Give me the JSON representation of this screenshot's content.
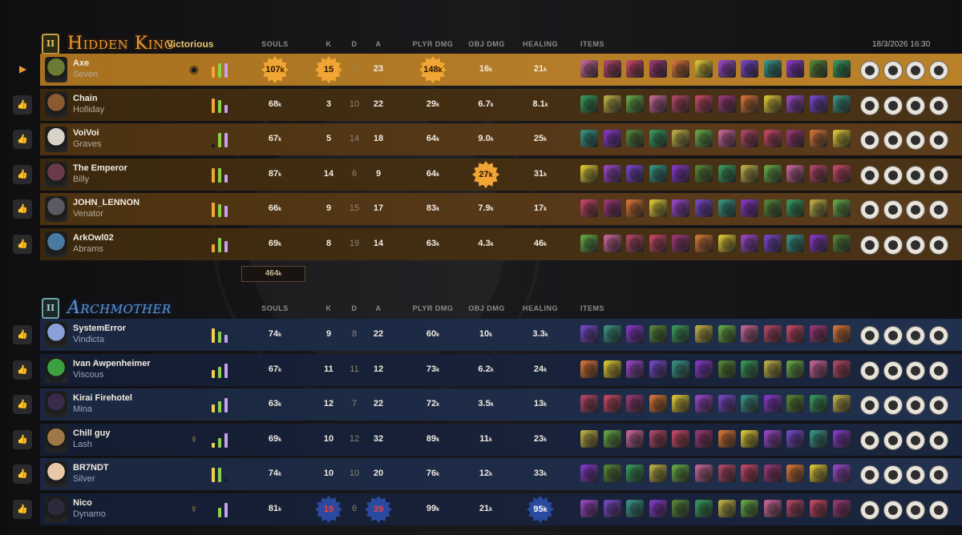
{
  "teams": [
    {
      "id": "amber",
      "badge": "II",
      "name": "Hidden King",
      "result": "Victorious",
      "timestamp_date": "18/3/2026",
      "timestamp_time": "16:30",
      "total_souls": "464",
      "players": [
        {
          "player": "Axe",
          "hero": "Seven",
          "souls": "107",
          "k": "15",
          "d": "3",
          "a": "23",
          "plyr": "148",
          "obj": "16",
          "heal": "21",
          "self": true,
          "highlight": [
            "souls",
            "k",
            "plyr"
          ],
          "portrait": "#6b7a34",
          "bars": [
            14,
            18,
            18
          ]
        },
        {
          "player": "Chain",
          "hero": "Holliday",
          "souls": "68",
          "k": "3",
          "d": "10",
          "a": "22",
          "plyr": "29",
          "obj": "6.7",
          "heal": "8.1",
          "portrait": "#8a5a30",
          "bars": [
            18,
            16,
            10
          ]
        },
        {
          "player": "VoiVoi",
          "hero": "Graves",
          "souls": "67",
          "k": "5",
          "d": "14",
          "a": "18",
          "plyr": "64",
          "obj": "9.0",
          "heal": "25",
          "portrait": "#d8d2c8",
          "bars": [
            4,
            18,
            18
          ]
        },
        {
          "player": "The Emperor",
          "hero": "Billy",
          "souls": "87",
          "k": "14",
          "d": "6",
          "a": "9",
          "plyr": "64",
          "obj": "27",
          "heal": "31",
          "highlight": [
            "obj"
          ],
          "portrait": "#6a3a4a",
          "bars": [
            18,
            18,
            10
          ]
        },
        {
          "player": "JOHN_LENNON",
          "hero": "Venator",
          "souls": "66",
          "k": "9",
          "d": "15",
          "a": "17",
          "plyr": "83",
          "obj": "7.9",
          "heal": "17",
          "portrait": "#5a5a62",
          "bars": [
            18,
            16,
            14
          ]
        },
        {
          "player": "ArkOwl02",
          "hero": "Abrams",
          "souls": "69",
          "k": "8",
          "d": "19",
          "a": "14",
          "plyr": "63",
          "obj": "4.3",
          "heal": "46",
          "portrait": "#4a7aa0",
          "bars": [
            10,
            18,
            14
          ]
        }
      ]
    },
    {
      "id": "blue",
      "badge": "II",
      "name": "Archmother",
      "total_souls": "",
      "players": [
        {
          "player": "SystemError",
          "hero": "Vindicta",
          "souls": "74",
          "k": "9",
          "d": "8",
          "a": "22",
          "plyr": "60",
          "obj": "10",
          "heal": "3.3",
          "portrait": "#8aa0d8",
          "bars": [
            18,
            14,
            10
          ]
        },
        {
          "player": "Ivan Awpenheimer",
          "hero": "Viscous",
          "souls": "67",
          "k": "11",
          "d": "11",
          "a": "12",
          "plyr": "73",
          "obj": "6.2",
          "heal": "24",
          "portrait": "#3aa040",
          "bars": [
            10,
            14,
            18
          ]
        },
        {
          "player": "Kirai Firehotel",
          "hero": "Mina",
          "souls": "63",
          "k": "12",
          "d": "7",
          "a": "22",
          "plyr": "72",
          "obj": "3.5",
          "heal": "13",
          "portrait": "#3a2a4a",
          "bars": [
            10,
            14,
            18
          ]
        },
        {
          "player": "Chill guy",
          "hero": "Lash",
          "souls": "69",
          "k": "10",
          "d": "12",
          "a": "32",
          "plyr": "89",
          "obj": "11",
          "heal": "23",
          "spec": true,
          "portrait": "#a07848",
          "bars": [
            6,
            12,
            18
          ]
        },
        {
          "player": "BR7NDT",
          "hero": "Silver",
          "souls": "74",
          "k": "10",
          "d": "10",
          "a": "20",
          "plyr": "76",
          "obj": "12",
          "heal": "33",
          "portrait": "#e8c8a8",
          "bars": [
            18,
            18,
            4
          ]
        },
        {
          "player": "Nico",
          "hero": "Dynamo",
          "souls": "81",
          "k": "15",
          "d": "6",
          "a": "39",
          "plyr": "99",
          "obj": "21",
          "heal": "95",
          "spec": true,
          "highlight": [
            "k",
            "a",
            "heal"
          ],
          "portrait": "#2a2a3a",
          "bars": [
            4,
            12,
            18
          ]
        }
      ]
    }
  ],
  "columns": {
    "souls": "SOULS",
    "k": "K",
    "d": "D",
    "a": "A",
    "plyr": "PLYR DMG",
    "obj": "OBJ DMG",
    "heal": "HEALING",
    "items": "ITEMS"
  },
  "unit_suffix": "k",
  "thumb_icon": "thumbs-up-icon",
  "row_arrow_icon": "play-arrow-icon",
  "colors": {
    "amber_accent": "#e79a30",
    "blue_accent": "#5a93d6",
    "gold_burst": "#f0a534",
    "blue_burst": "#2a4aa0"
  }
}
